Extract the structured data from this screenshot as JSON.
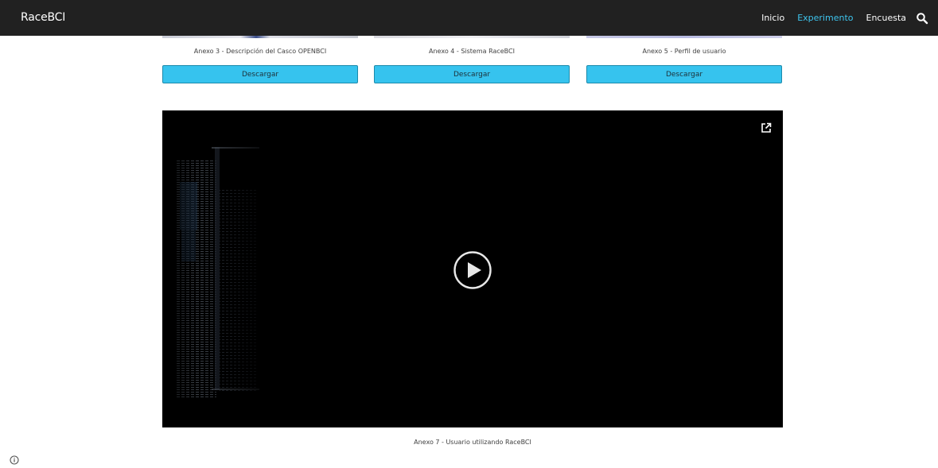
{
  "header": {
    "site_title": "RaceBCI",
    "nav": [
      {
        "label": "Inicio",
        "active": false
      },
      {
        "label": "Experimento",
        "active": true
      },
      {
        "label": "Encuesta",
        "active": false
      }
    ],
    "search_icon": "search-icon"
  },
  "annexes": [
    {
      "caption": "Anexo 3 - Descripción del Casco OPENBCI",
      "button_label": "Descargar"
    },
    {
      "caption": "Anexo 4 - Sistema RaceBCI",
      "button_label": "Descargar"
    },
    {
      "caption": "Anexo 5 - Perfil de usuario",
      "button_label": "Descargar"
    }
  ],
  "video": {
    "caption": "Anexo 7 - Usuario utilizando RaceBCI",
    "play_icon": "play-icon",
    "open_icon": "open-in-new-icon"
  },
  "footer": {
    "info_icon": "info-icon"
  },
  "colors": {
    "header_bg": "#212121",
    "accent": "#3ec5ee",
    "button_bg": "#36c3ee",
    "video_bg": "#000000"
  }
}
